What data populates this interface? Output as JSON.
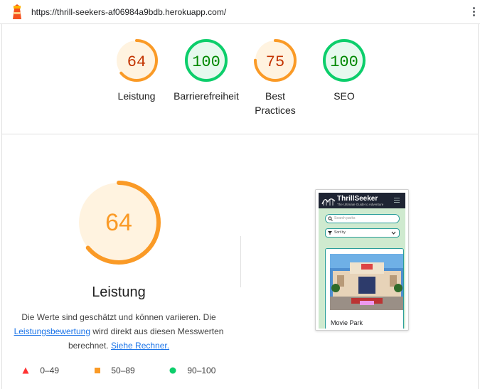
{
  "browser": {
    "url": "https://thrill-seekers-af06984a9bdb.herokuapp.com/",
    "menu_icon": "kebab-menu-icon",
    "site_icon": "lighthouse-icon"
  },
  "scores": [
    {
      "label": "Leistung",
      "score": "64",
      "value": 64,
      "color": "#fa9a26",
      "text_color": "#c33300",
      "bg": "#fff3e0"
    },
    {
      "label": "Barrierefreiheit",
      "score": "100",
      "value": 100,
      "color": "#0cce6b",
      "text_color": "#008800",
      "bg": "#e6f9ee"
    },
    {
      "label_line1": "Best",
      "label_line2": "Practices",
      "score": "75",
      "value": 75,
      "color": "#fa9a26",
      "text_color": "#c33300",
      "bg": "#fff3e0"
    },
    {
      "label": "SEO",
      "score": "100",
      "value": 100,
      "color": "#0cce6b",
      "text_color": "#008800",
      "bg": "#e6f9ee"
    }
  ],
  "detail": {
    "score": "64",
    "value": 64,
    "title": "Leistung",
    "desc_part1": "Die Werte sind geschätzt und können variieren. Die",
    "desc_link1": "Leistungsbewertung",
    "desc_part2": "wird direkt aus diesen Messwerten berechnet.",
    "desc_link2": "Siehe Rechner."
  },
  "legend": [
    {
      "range": "0–49",
      "shape": "triangle",
      "color": "#ff3333"
    },
    {
      "range": "50–89",
      "shape": "square",
      "color": "#fa9a26"
    },
    {
      "range": "90–100",
      "shape": "circle",
      "color": "#0cce6b"
    }
  ],
  "thumbnail": {
    "brand": "ThrillSeeker",
    "tagline": "The Ultimate Guide to Adventure",
    "search_placeholder": "Search parks",
    "sort_label": "Sort by",
    "card_title": "Movie Park"
  }
}
